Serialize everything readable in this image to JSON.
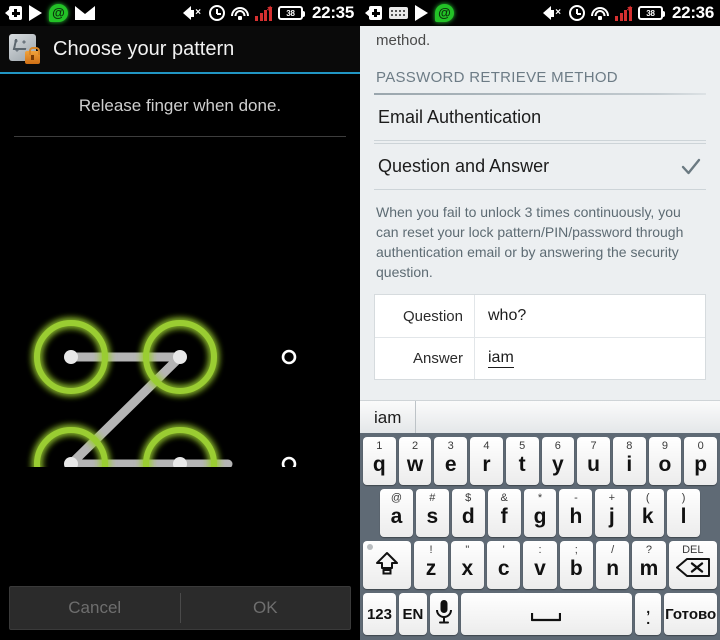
{
  "left": {
    "statusbar": {
      "left_icons": [
        "back-plus-icon",
        "play-icon",
        "at-message-icon",
        "envelope-icon"
      ],
      "mute_icon": "mute-icon",
      "alarm_icon": "alarm-icon",
      "wifi_icon": "wifi-icon",
      "signal_icon": "signal-icon",
      "battery_level": "38",
      "time": "22:35"
    },
    "title": "Choose your pattern",
    "title_icon": "pattern-lock-icon",
    "instruction": "Release finger when done.",
    "pattern": {
      "rows": 3,
      "cols": 3,
      "selected_nodes": [
        0,
        1,
        3,
        4
      ],
      "path": [
        0,
        1,
        3,
        4
      ],
      "trailing_segment": true,
      "node_color": "#9acd32",
      "line_color": "#b0b0b0"
    },
    "buttons": {
      "cancel": "Cancel",
      "ok": "OK"
    }
  },
  "right": {
    "statusbar": {
      "left_icons": [
        "back-plus-icon",
        "keyboard-icon",
        "play-icon",
        "at-message-icon"
      ],
      "mute_icon": "mute-icon",
      "alarm_icon": "alarm-icon",
      "wifi_icon": "wifi-icon",
      "signal_icon": "signal-icon",
      "battery_level": "38",
      "time": "22:36"
    },
    "fragment_text": "method.",
    "section_header": "PASSWORD RETRIEVE METHOD",
    "options": [
      {
        "label": "Email Authentication",
        "checked": false
      },
      {
        "label": "Question and Answer",
        "checked": true
      }
    ],
    "description": "When you fail to unlock 3 times continuously, you can reset your lock pattern/PIN/password through authentication email or by answering the security question.",
    "qa": [
      {
        "key": "Question",
        "value": "who?",
        "underlined": false
      },
      {
        "key": "Answer",
        "value": "iam",
        "underlined": true
      }
    ],
    "keyboard": {
      "suggestion": "iam",
      "rows": [
        [
          {
            "main": "q",
            "alt": "1"
          },
          {
            "main": "w",
            "alt": "2"
          },
          {
            "main": "e",
            "alt": "3"
          },
          {
            "main": "r",
            "alt": "4"
          },
          {
            "main": "t",
            "alt": "5"
          },
          {
            "main": "y",
            "alt": "6"
          },
          {
            "main": "u",
            "alt": "7"
          },
          {
            "main": "i",
            "alt": "8"
          },
          {
            "main": "o",
            "alt": "9"
          },
          {
            "main": "p",
            "alt": "0"
          }
        ],
        [
          {
            "main": "a",
            "alt": "@"
          },
          {
            "main": "s",
            "alt": "#"
          },
          {
            "main": "d",
            "alt": "$"
          },
          {
            "main": "f",
            "alt": "&"
          },
          {
            "main": "g",
            "alt": "*"
          },
          {
            "main": "h",
            "alt": "-"
          },
          {
            "main": "j",
            "alt": "+"
          },
          {
            "main": "k",
            "alt": "("
          },
          {
            "main": "l",
            "alt": ")"
          }
        ],
        [
          {
            "main": "shift-icon",
            "alt": ""
          },
          {
            "main": "z",
            "alt": "!"
          },
          {
            "main": "x",
            "alt": "\""
          },
          {
            "main": "c",
            "alt": "'"
          },
          {
            "main": "v",
            "alt": ":"
          },
          {
            "main": "b",
            "alt": ";"
          },
          {
            "main": "n",
            "alt": "/"
          },
          {
            "main": "m",
            "alt": "?"
          },
          {
            "main": "DEL",
            "alt": ""
          }
        ]
      ],
      "bottom_row": {
        "numeric": "123",
        "language": "EN",
        "mic": "microphone-icon",
        "space": "space-icon",
        "punct_top": ",",
        "punct_bottom": ".",
        "done": "Готово"
      }
    }
  }
}
